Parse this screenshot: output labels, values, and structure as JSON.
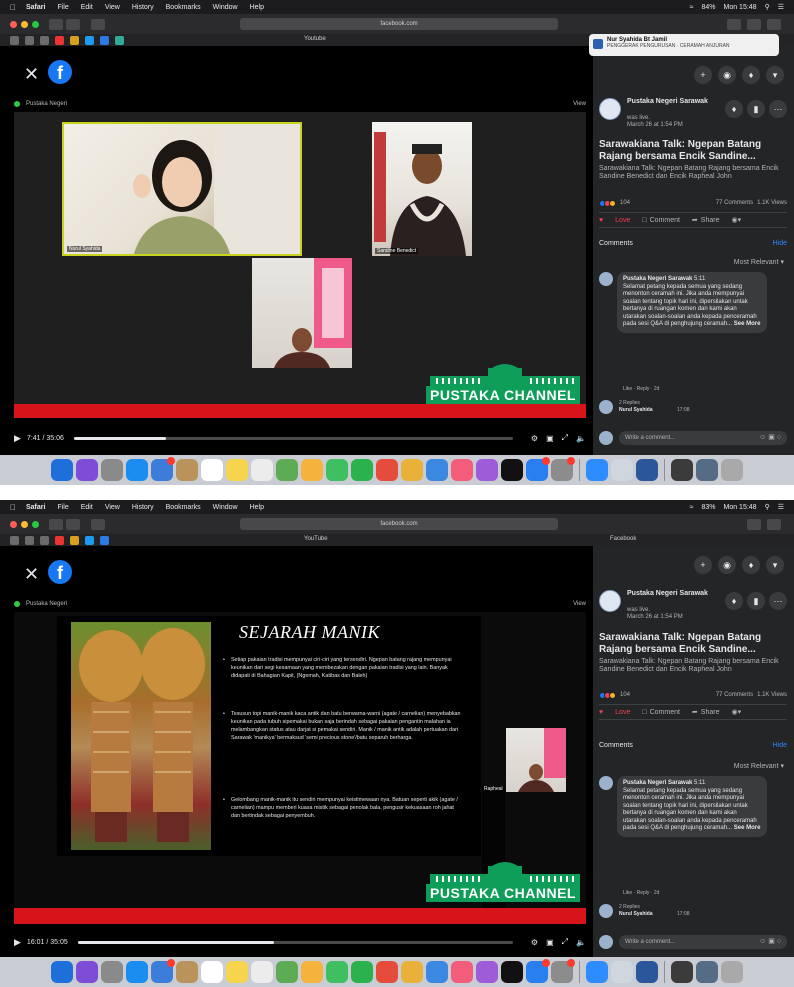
{
  "screenshots": [
    {
      "menubar": {
        "apple": "",
        "items": [
          "Safari",
          "File",
          "Edit",
          "View",
          "History",
          "Bookmarks",
          "Window",
          "Help"
        ],
        "battery": "84%",
        "clock": "Mon 15:48"
      },
      "url": "facebook.com",
      "tabs": {
        "left": "Youtube",
        "right": ""
      },
      "notification": {
        "title": "Nur Syahida Bt Jamil",
        "body": "PENGGERAK PENGURUSAN · CERAMAH ANJURAN"
      },
      "zoom_header": "Pustaka Negeri",
      "zoom_view": "View",
      "participants": [
        {
          "label": "Nurul Syahida"
        },
        {
          "label": "Sandine Benedict"
        },
        {
          "label": ""
        }
      ],
      "banner_text": "PUSTAKA CHANNEL",
      "player": {
        "time": "7:41 / 35:06",
        "progress": 0.21
      },
      "post": {
        "page_name": "Pustaka Negeri Sarawak",
        "status": "was live.",
        "date": "March 26 at 1:54 PM",
        "title": "Sarawakiana Talk: Ngepan Batang Rajang bersama Encik Sandine...",
        "description": "Sarawakiana Talk: Ngepan Batang Rajang bersama Encik Sandine Benedict dan Encik Rapheal John",
        "reactions": "104",
        "comments_count": "77 Comments",
        "views": "1.1K Views",
        "love": "Love",
        "comment": "Comment",
        "share": "Share",
        "comments_label": "Comments",
        "hide": "Hide",
        "sort": "Most Relevant",
        "comment_author": "Pustaka Negeri Sarawak",
        "comment_time": "5:11",
        "comment_text": "Selamat petang kepada semua yang sedang menonton ceramah ini. Jika anda mempunyai soalan tentang topik hari ini, dipersilakan untak bertanya di ruangan komen dan kami akan utarakan soalan-soalan anda kepada penceramah pada sesi Q&A di penghujung ceramah...",
        "see_more": "See More",
        "comment_meta": "Like · Reply · 2d",
        "reply": "2 Replies",
        "reply_author": "Nurul Syahida",
        "reply_time": "17:08",
        "write": "Write a comment..."
      }
    },
    {
      "menubar": {
        "apple": "",
        "items": [
          "Safari",
          "File",
          "Edit",
          "View",
          "History",
          "Bookmarks",
          "Window",
          "Help"
        ],
        "battery": "83%",
        "clock": "Mon 15:48"
      },
      "url": "facebook.com",
      "tabs": {
        "left": "YouTube",
        "right": "Facebook"
      },
      "zoom_header": "Pustaka Negeri",
      "zoom_view": "View",
      "slide": {
        "title": "SEJARAH MANIK",
        "bullets": [
          "Setiap pakaian tradisi mempunyai ciri-ciri yang tersendiri. Ngepan batang rajang mempunyai keunikan dari segi kesamaan yang membezakan dengan pakaian tradisi yang lain. Banyak didapati di Bahagian Kapit, (Ngemah, Katibas dan Baleh)",
          "Tesusun topi manik-manik kaca antik dan batu berwarna-warni (agate / carnelian) menyebabkan keunikan pada tubuh sipemakai bukan saja berindah sebagai pakaian pengantin malahan ia melambangkan status atau darjat si pemakai sendiri. Manik / manik antik adalah pertuakan dari Sarawak 'manikya' bermaksud 'semi precious stone'/batu separuh berharga.",
          "Gelombang manik-manik itu sendiri mempunyai keistimewaan nya. Batuan seperti akik (agate / carnelian) mampu memberi kuasa mistik sebagai penolak bala, pengusir kekuasaan roh jahat dan bertindak sebagai penyembuh."
        ]
      },
      "pip_label": "Rapheal",
      "banner_text": "PUSTAKA CHANNEL",
      "player": {
        "time": "16:01 / 35:05",
        "progress": 0.45
      },
      "post": {
        "page_name": "Pustaka Negeri Sarawak",
        "status": "was live.",
        "date": "March 26 at 1:54 PM",
        "title": "Sarawakiana Talk: Ngepan Batang Rajang bersama Encik Sandine...",
        "description": "Sarawakiana Talk: Ngepan Batang Rajang bersama Encik Sandine Benedict dan Encik Rapheal John",
        "reactions": "104",
        "comments_count": "77 Comments",
        "views": "1.1K Views",
        "love": "Love",
        "comment": "Comment",
        "share": "Share",
        "comments_label": "Comments",
        "hide": "Hide",
        "sort": "Most Relevant",
        "comment_author": "Pustaka Negeri Sarawak",
        "comment_time": "5:11",
        "comment_text": "Selamat petang kepada semua yang sedang menonton ceramah ini. Jika anda mempunyai soalan tentang topik hari ini, dipersilakan untak bertanya di ruangan komen dan kami akan utarakan soalan-soalan anda kepada penceramah pada sesi Q&A di penghujung ceramah...",
        "see_more": "See More",
        "comment_meta": "Like · Reply · 2d",
        "reply": "2 Replies",
        "reply_author": "Nurul Syahida",
        "reply_time": "17:08",
        "write": "Write a comment..."
      }
    }
  ],
  "colors": {
    "fb_blue": "#1877f2",
    "love_red": "#f33e58",
    "banner_green": "#0f9e5a",
    "strip_red": "#d8141b"
  },
  "icons": [
    "apple-icon",
    "close-icon",
    "facebook-logo-icon",
    "play-icon",
    "settings-icon",
    "volume-icon",
    "fullscreen-icon",
    "plus-icon",
    "messenger-icon",
    "bell-icon",
    "chevron-down-icon",
    "more-icon",
    "love-icon",
    "comment-icon",
    "share-icon",
    "emoji-icon",
    "camera-icon",
    "gif-icon"
  ]
}
